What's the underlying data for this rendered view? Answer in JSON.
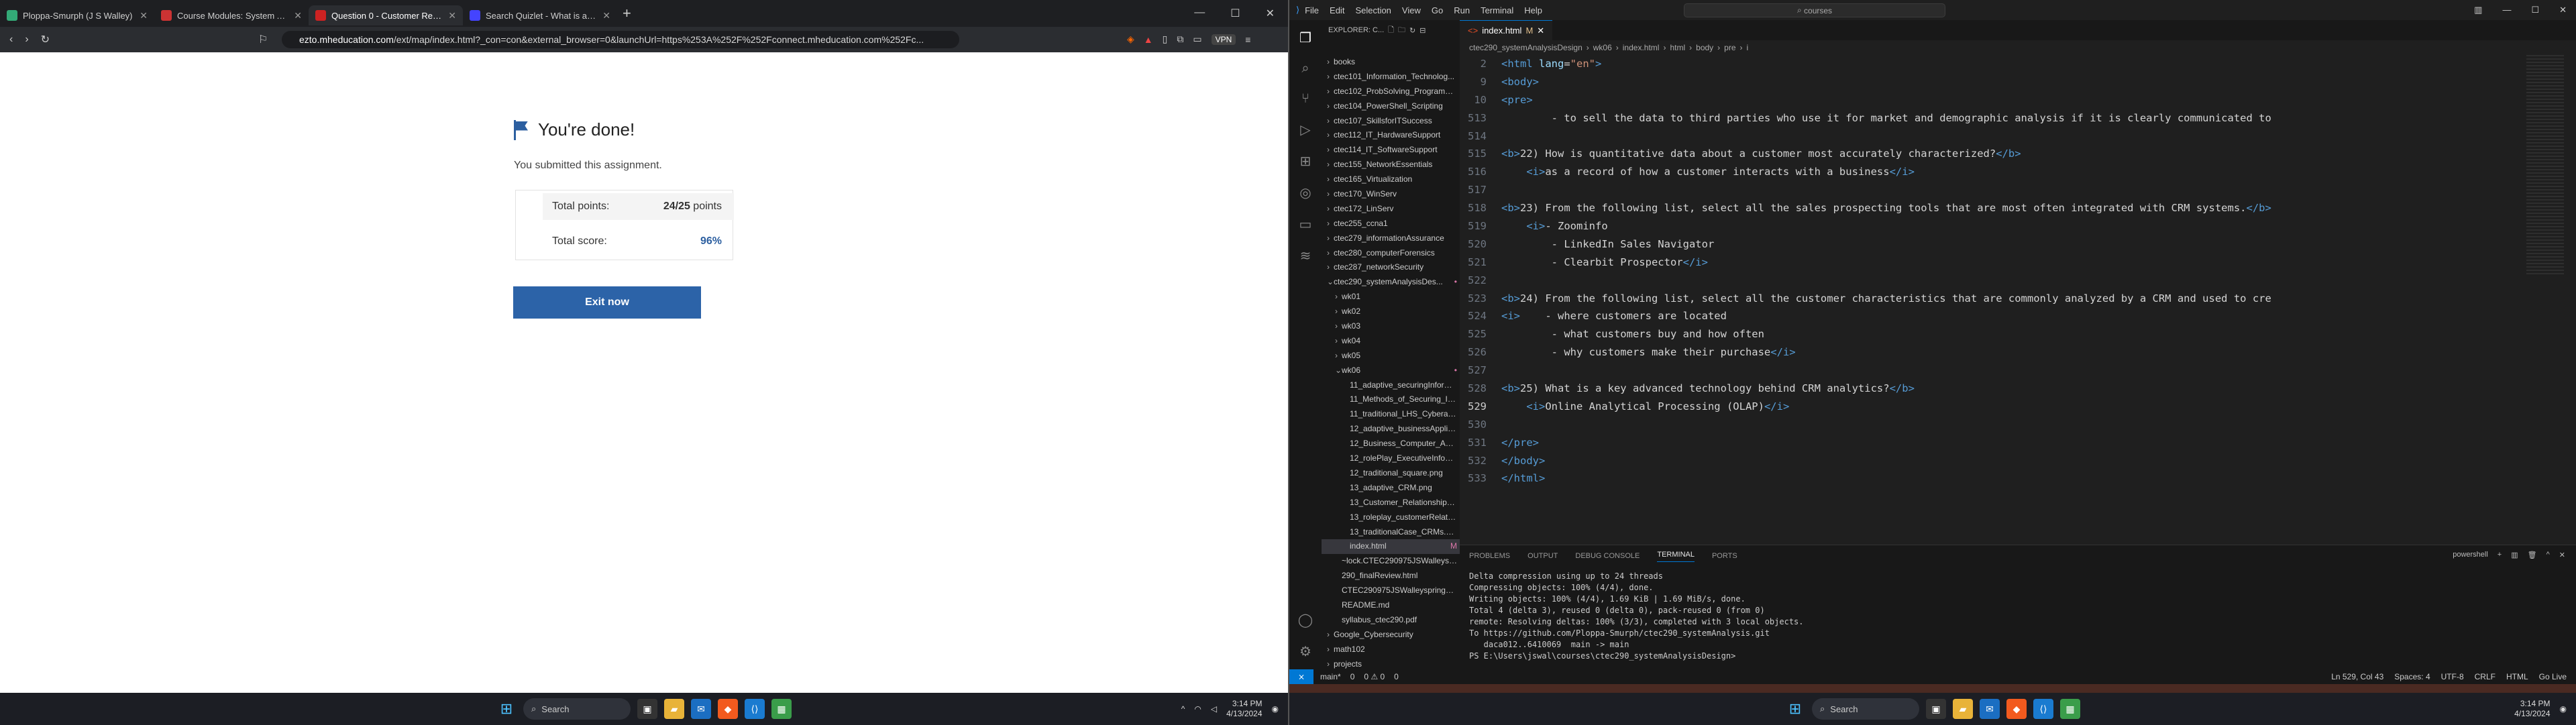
{
  "browser": {
    "tabs": [
      {
        "title": "Ploppa-Smurph (J S Walley)",
        "color": "#3a7"
      },
      {
        "title": "Course Modules: System Analysis an",
        "color": "#c33"
      },
      {
        "title": "Question 0 - Customer Relationsh",
        "color": "#c22",
        "active": true
      },
      {
        "title": "Search Quizlet - What is a key adva",
        "color": "#44f"
      }
    ],
    "url_domain": "ezto.mheducation.com",
    "url_rest": "/ext/map/index.html?_con=con&external_browser=0&launchUrl=https%253A%252F%252Fconnect.mheducation.com%252Fc...",
    "vpn": "VPN"
  },
  "assignment": {
    "heading": "You're done!",
    "subtext": "You submitted this assignment.",
    "points_label": "Total points:",
    "points_value": "24/25",
    "points_unit": " points",
    "score_label": "Total score:",
    "score_value": "96%",
    "exit_button": "Exit now"
  },
  "taskbar_left": {
    "search": "Search",
    "time": "3:14 PM",
    "date": "4/13/2024"
  },
  "taskbar_right": {
    "search": "Search",
    "time": "3:14 PM",
    "date": "4/13/2024"
  },
  "vscode": {
    "menu": [
      "File",
      "Edit",
      "Selection",
      "View",
      "Go",
      "Run",
      "Terminal",
      "Help"
    ],
    "search": "courses",
    "explorer_title": "EXPLORER: C...",
    "tab": "index.html",
    "tab_mod": "M",
    "breadcrumb": [
      "ctec290_systemAnalysisDesign",
      "wk06",
      "index.html",
      "html",
      "body",
      "pre",
      "i"
    ],
    "tree": [
      {
        "t": "books",
        "c": ">",
        "i": 0
      },
      {
        "t": "ctec101_Information_Technolog...",
        "c": ">",
        "i": 0
      },
      {
        "t": "ctec102_ProbSolving_ProgramTech",
        "c": ">",
        "i": 0
      },
      {
        "t": "ctec104_PowerShell_Scripting",
        "c": ">",
        "i": 0
      },
      {
        "t": "ctec107_SkillsforITSuccess",
        "c": ">",
        "i": 0
      },
      {
        "t": "ctec112_IT_HardwareSupport",
        "c": ">",
        "i": 0
      },
      {
        "t": "ctec114_IT_SoftwareSupport",
        "c": ">",
        "i": 0
      },
      {
        "t": "ctec155_NetworkEssentials",
        "c": ">",
        "i": 0
      },
      {
        "t": "ctec165_Virtualization",
        "c": ">",
        "i": 0
      },
      {
        "t": "ctec170_WinServ",
        "c": ">",
        "i": 0
      },
      {
        "t": "ctec172_LinServ",
        "c": ">",
        "i": 0
      },
      {
        "t": "ctec255_ccna1",
        "c": ">",
        "i": 0
      },
      {
        "t": "ctec279_informationAssurance",
        "c": ">",
        "i": 0
      },
      {
        "t": "ctec280_computerForensics",
        "c": ">",
        "i": 0
      },
      {
        "t": "ctec287_networkSecurity",
        "c": ">",
        "i": 0
      },
      {
        "t": "ctec290_systemAnalysisDes...",
        "c": "v",
        "i": 0,
        "dot": true
      },
      {
        "t": "wk01",
        "c": ">",
        "i": 1
      },
      {
        "t": "wk02",
        "c": ">",
        "i": 1
      },
      {
        "t": "wk03",
        "c": ">",
        "i": 1
      },
      {
        "t": "wk04",
        "c": ">",
        "i": 1
      },
      {
        "t": "wk05",
        "c": ">",
        "i": 1
      },
      {
        "t": "wk06",
        "c": "v",
        "i": 1,
        "dot": true
      },
      {
        "t": "11_adaptive_securingInformat...",
        "c": "",
        "i": 2
      },
      {
        "t": "11_Methods_of_Securing_Info...",
        "c": "",
        "i": 2
      },
      {
        "t": "11_traditional_LHS_Cyberatta...",
        "c": "",
        "i": 2
      },
      {
        "t": "12_adaptive_businessApplicati...",
        "c": "",
        "i": 2
      },
      {
        "t": "12_Business_Computer_Applic...",
        "c": "",
        "i": 2
      },
      {
        "t": "12_rolePlay_ExecutiveInfoSys...",
        "c": "",
        "i": 2
      },
      {
        "t": "12_traditional_square.png",
        "c": "",
        "i": 2
      },
      {
        "t": "13_adaptive_CRM.png",
        "c": "",
        "i": 2
      },
      {
        "t": "13_Customer_Relationship_Ma...",
        "c": "",
        "i": 2
      },
      {
        "t": "13_roleplay_customerRelation...",
        "c": "",
        "i": 2
      },
      {
        "t": "13_traditionalCase_CRMs.png",
        "c": "",
        "i": 2
      },
      {
        "t": "index.html",
        "c": "",
        "i": 2,
        "sel": true,
        "m": "M"
      },
      {
        "t": "~lock.CTEC290975JSWalleyspri...",
        "c": "",
        "i": 1
      },
      {
        "t": "290_finalReview.html",
        "c": "",
        "i": 1
      },
      {
        "t": "CTEC290975JSWalleyspring202...",
        "c": "",
        "i": 1
      },
      {
        "t": "README.md",
        "c": "",
        "i": 1
      },
      {
        "t": "syllabus_ctec290.pdf",
        "c": "",
        "i": 1
      },
      {
        "t": "Google_Cybersecurity",
        "c": ">",
        "i": 0
      },
      {
        "t": "math102",
        "c": ">",
        "i": 0
      },
      {
        "t": "projects",
        "c": ">",
        "i": 0
      }
    ],
    "code": [
      {
        "n": "2",
        "s": [
          [
            "tag",
            "<html "
          ],
          [
            "att",
            "lang"
          ],
          [
            "c",
            "="
          ],
          [
            "str",
            "\"en\""
          ],
          [
            "tag",
            ">"
          ]
        ]
      },
      {
        "n": "9",
        "s": [
          [
            "tag",
            "<body>"
          ]
        ]
      },
      {
        "n": "10",
        "s": [
          [
            "tag",
            "<pre>"
          ]
        ]
      },
      {
        "n": "513",
        "s": [
          [
            "c",
            "        - to sell the data to third parties who use it for market and demographic analysis if it is clearly communicated to"
          ]
        ]
      },
      {
        "n": "514",
        "s": []
      },
      {
        "n": "515",
        "s": [
          [
            "tag",
            "<b>"
          ],
          [
            "c",
            "22) How is quantitative data about a customer most accurately characterized?"
          ],
          [
            "tag",
            "</b>"
          ]
        ]
      },
      {
        "n": "516",
        "s": [
          [
            "c",
            "    "
          ],
          [
            "tag",
            "<i>"
          ],
          [
            "c",
            "as a record of how a customer interacts with a business"
          ],
          [
            "tag",
            "</i>"
          ]
        ]
      },
      {
        "n": "517",
        "s": []
      },
      {
        "n": "518",
        "s": [
          [
            "tag",
            "<b>"
          ],
          [
            "c",
            "23) From the following list, select all the sales prospecting tools that are most often integrated with CRM systems."
          ],
          [
            "tag",
            "</b>"
          ]
        ]
      },
      {
        "n": "519",
        "s": [
          [
            "c",
            "    "
          ],
          [
            "tag",
            "<i>"
          ],
          [
            "c",
            "- Zoominfo"
          ]
        ]
      },
      {
        "n": "520",
        "s": [
          [
            "c",
            "        - LinkedIn Sales Navigator"
          ]
        ]
      },
      {
        "n": "521",
        "s": [
          [
            "c",
            "        - Clearbit Prospector"
          ],
          [
            "tag",
            "</i>"
          ]
        ]
      },
      {
        "n": "522",
        "s": []
      },
      {
        "n": "523",
        "s": [
          [
            "tag",
            "<b>"
          ],
          [
            "c",
            "24) From the following list, select all the customer characteristics that are commonly analyzed by a CRM and used to cre"
          ]
        ]
      },
      {
        "n": "524",
        "s": [
          [
            "tag",
            "<i>"
          ],
          [
            "c",
            "    - where customers are located"
          ]
        ]
      },
      {
        "n": "525",
        "s": [
          [
            "c",
            "        - what customers buy and how often"
          ]
        ]
      },
      {
        "n": "526",
        "s": [
          [
            "c",
            "        - why customers make their purchase"
          ],
          [
            "tag",
            "</i>"
          ]
        ]
      },
      {
        "n": "527",
        "s": []
      },
      {
        "n": "528",
        "s": [
          [
            "tag",
            "<b>"
          ],
          [
            "c",
            "25) What is a key advanced technology behind CRM analytics?"
          ],
          [
            "tag",
            "</b>"
          ]
        ]
      },
      {
        "n": "529",
        "s": [
          [
            "c",
            "    "
          ],
          [
            "tag",
            "<i>"
          ],
          [
            "c",
            "Online Analytical Processing (OLAP)"
          ],
          [
            "tag",
            "</i>"
          ]
        ],
        "cur": true
      },
      {
        "n": "530",
        "s": []
      },
      {
        "n": "531",
        "s": [
          [
            "tag",
            "</pre>"
          ]
        ]
      },
      {
        "n": "532",
        "s": [
          [
            "tag",
            "</body>"
          ]
        ]
      },
      {
        "n": "533",
        "s": [
          [
            "tag",
            "</html>"
          ]
        ]
      }
    ],
    "panel_tabs": [
      "PROBLEMS",
      "OUTPUT",
      "DEBUG CONSOLE",
      "TERMINAL",
      "PORTS"
    ],
    "terminal_shell": "powershell",
    "terminal": "Delta compression using up to 24 threads\nCompressing objects: 100% (4/4), done.\nWriting objects: 100% (4/4), 1.69 KiB | 1.69 MiB/s, done.\nTotal 4 (delta 3), reused 0 (delta 0), pack-reused 0 (from 0)\nremote: Resolving deltas: 100% (3/3), completed with 3 local objects.\nTo https://github.com/Ploppa-Smurph/ctec290_systemAnalysis.git\n   daca012..6410069  main -> main\nPS E:\\Users\\jswal\\courses\\ctec290_systemAnalysisDesign> ",
    "status_left": [
      "main*",
      "0",
      "0 ⚠ 0",
      "0"
    ],
    "status_right": [
      "Ln 529, Col 43",
      "Spaces: 4",
      "UTF-8",
      "CRLF",
      "HTML",
      "Go Live"
    ]
  }
}
